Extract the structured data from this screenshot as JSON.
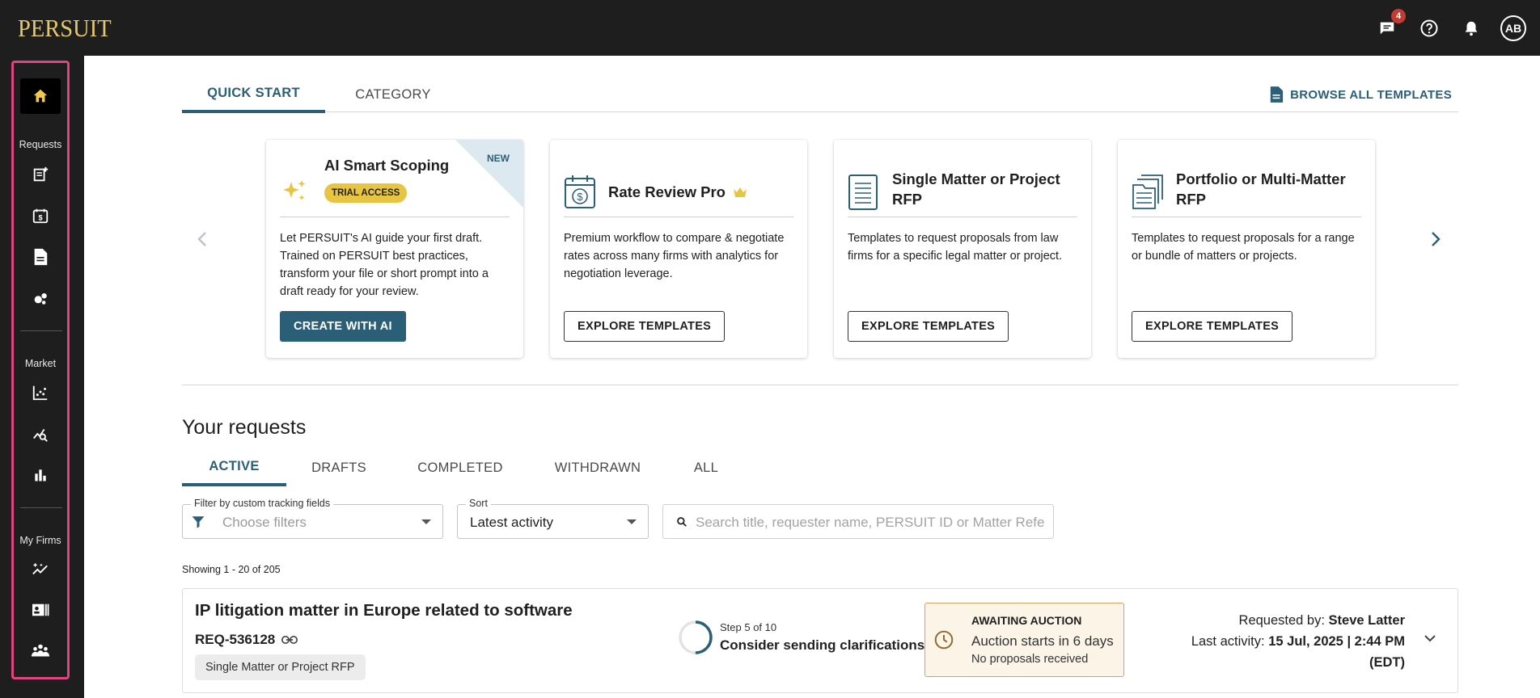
{
  "brand": {
    "logo": "PERSUIT"
  },
  "topbar": {
    "messages_badge": "4",
    "avatar_initials": "AB"
  },
  "sidebar": {
    "section_requests": "Requests",
    "section_market": "Market",
    "section_firms": "My Firms",
    "frame_color": "#e0437f"
  },
  "main_tabs": {
    "quick_start": "QUICK START",
    "category": "CATEGORY",
    "browse_all": "BROWSE ALL TEMPLATES"
  },
  "cards": [
    {
      "title": "AI Smart Scoping",
      "badge": "TRIAL ACCESS",
      "ribbon": "NEW",
      "description": "Let PERSUIT's AI guide your first draft. Trained on PERSUIT best practices, transform your file or short prompt into a draft ready for your review.",
      "button": "CREATE WITH AI"
    },
    {
      "title": "Rate Review Pro",
      "description": "Premium workflow to compare & negotiate rates across many firms with analytics for negotiation leverage.",
      "button": "EXPLORE TEMPLATES"
    },
    {
      "title": "Single Matter or Project RFP",
      "description": "Templates to request proposals from law firms for a specific legal matter or project.",
      "button": "EXPLORE TEMPLATES"
    },
    {
      "title": "Portfolio or Multi-Matter RFP",
      "description": "Templates to request proposals for a range or bundle of matters or projects.",
      "button": "EXPLORE TEMPLATES"
    }
  ],
  "requests": {
    "heading": "Your requests",
    "tabs": [
      "ACTIVE",
      "DRAFTS",
      "COMPLETED",
      "WITHDRAWN",
      "ALL"
    ],
    "filter": {
      "label": "Filter by custom tracking fields",
      "placeholder": "Choose filters"
    },
    "sort": {
      "label": "Sort",
      "value": "Latest activity"
    },
    "search": {
      "placeholder": "Search title, requester name, PERSUIT ID or Matter Refe"
    },
    "showing": "Showing 1 - 20 of 205",
    "items": [
      {
        "title": "IP litigation matter in Europe related to software",
        "id": "REQ-536128",
        "type": "Single Matter or Project RFP",
        "step_label": "Step 5 of 10",
        "step_fraction": 0.5,
        "step_action": "Consider sending clarifications",
        "status_title": "AWAITING AUCTION",
        "status_sub": "Auction starts in 6 days",
        "status_small": "No proposals received",
        "requested_by_label": "Requested by:",
        "requested_by": "Steve Latter",
        "last_activity_label": "Last activity:",
        "last_activity": "15 Jul, 2025 | 2:44 PM",
        "timezone": "(EDT)"
      }
    ]
  },
  "colors": {
    "accent": "#2b5f78",
    "brand_gold": "#e5c76b",
    "trial_badge": "#e8c443",
    "status_bg": "#fbf4e7"
  }
}
